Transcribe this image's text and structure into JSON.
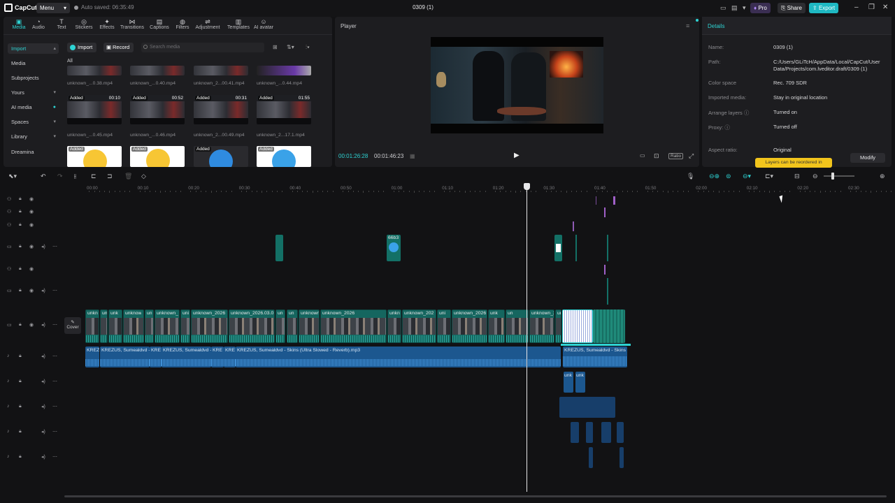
{
  "app": {
    "logo": "CapCut",
    "menu_label": "Menu",
    "autosave": "Auto saved: 06:35:49",
    "project_title": "0309 (1)",
    "pro_label": "Pro",
    "share_label": "Share",
    "export_label": "Export"
  },
  "colors": {
    "accent": "#2ed3d3",
    "video_clip": "#177a73",
    "audio_clip": "#1f5d9c",
    "tip": "#f2c51c"
  },
  "toolbar": {
    "items": [
      {
        "label": "Media",
        "icon": "media-icon",
        "active": true
      },
      {
        "label": "Audio",
        "icon": "audio-icon"
      },
      {
        "label": "Text",
        "icon": "text-icon"
      },
      {
        "label": "Stickers",
        "icon": "stickers-icon"
      },
      {
        "label": "Effects",
        "icon": "effects-icon"
      },
      {
        "label": "Transitions",
        "icon": "transitions-icon"
      },
      {
        "label": "Captions",
        "icon": "captions-icon"
      },
      {
        "label": "Filters",
        "icon": "filters-icon"
      },
      {
        "label": "Adjustment",
        "icon": "adjustment-icon"
      },
      {
        "label": "Templates",
        "icon": "templates-icon"
      },
      {
        "label": "AI avatar",
        "icon": "ai-avatar-icon"
      }
    ]
  },
  "sidebar": {
    "items": [
      {
        "label": "Import",
        "selected": true,
        "arrow": "▴"
      },
      {
        "label": "Media",
        "selected": false,
        "arrow": ""
      },
      {
        "label": "Subprojects",
        "selected": false,
        "arrow": ""
      },
      {
        "label": "Yours",
        "selected": false,
        "arrow": "▾"
      },
      {
        "label": "AI media",
        "selected": false,
        "arrow": "●"
      },
      {
        "label": "Spaces",
        "selected": false,
        "arrow": "▾"
      },
      {
        "label": "Library",
        "selected": false,
        "arrow": "▾"
      },
      {
        "label": "Dreamina",
        "selected": false,
        "arrow": ""
      }
    ]
  },
  "media": {
    "import_label": "Import",
    "record_label": "Record",
    "search_placeholder": "Search media",
    "filter_all": "All",
    "row1_names": [
      "unknown_...0.38.mp4",
      "unknown_...0.40.mp4",
      "unknown_2...00.41.mp4",
      "unknown_...0.44.mp4"
    ],
    "row2": [
      {
        "badge": "Added",
        "duration": "00:10",
        "name": "unknown_...0.45.mp4"
      },
      {
        "badge": "Added",
        "duration": "00:52",
        "name": "unknown_...0.46.mp4"
      },
      {
        "badge": "Added",
        "duration": "00:31",
        "name": "unknown_2...00.49.mp4"
      },
      {
        "badge": "Added",
        "duration": "01:55",
        "name": "unknown_2...17.1.mp4"
      }
    ],
    "row3_badges": [
      "Added",
      "Added",
      "Added",
      "Added"
    ]
  },
  "player": {
    "title": "Player",
    "current_time": "00:01:26:28",
    "total_time": "00:01:46:23",
    "ratio_label": "Ratio"
  },
  "details": {
    "title": "Details",
    "rows": [
      {
        "label": "Name:",
        "value": "0309 (1)"
      },
      {
        "label": "Path:",
        "value": "C:/Users/GLiTcH/AppData/Local/CapCut/User Data/Projects/com.lveditor.draft/0309 (1)"
      },
      {
        "label": "Color space",
        "value": "Rec. 709 SDR"
      },
      {
        "label": "Imported media:",
        "value": "Stay in original location"
      },
      {
        "label": "Arrange layers ⓘ",
        "value": "Turned on"
      },
      {
        "label": "Proxy: ⓘ",
        "value": "Turned off"
      },
      {
        "label": "Aspect ratio:",
        "value": "Original"
      }
    ],
    "tip": "Layers can be reordered in",
    "modify_label": "Modify"
  },
  "ruler": {
    "ticks": [
      "00:00",
      "00:10",
      "00:20",
      "00:30",
      "00:40",
      "00:50",
      "01:00",
      "01:10",
      "01:20",
      "01:30",
      "01:40",
      "01:50",
      "02:00",
      "02:10",
      "02:20",
      "02:30"
    ]
  },
  "timeline": {
    "cover_label": "Cover",
    "video_labels": [
      "unkn",
      "un",
      "unk",
      "unknow",
      "un",
      "unknown_",
      "uni",
      "unknown_2026",
      "unknown_2026.03.0",
      "un",
      "un",
      "unknown",
      "unknown_2026",
      "unkn",
      "unknown_202",
      "uni",
      "unknown_2026",
      "unk",
      "un",
      "unknown_2",
      "ur"
    ],
    "audio_label_main": "KREZUS, Sumealdvd - Skins (Ultra Slowed - Reverb).mp3",
    "audio_label_short": [
      "KREZ",
      "KREZUS, Sumealdvd -",
      "KRE",
      "KREZUS, Sumealdvd - !",
      "KRE",
      "KRE"
    ],
    "audio_label_right": "KREZUS, Sumealdvd - Skins (L",
    "sticker_label": "66b3",
    "small_labels": [
      "unk",
      "unk"
    ]
  }
}
